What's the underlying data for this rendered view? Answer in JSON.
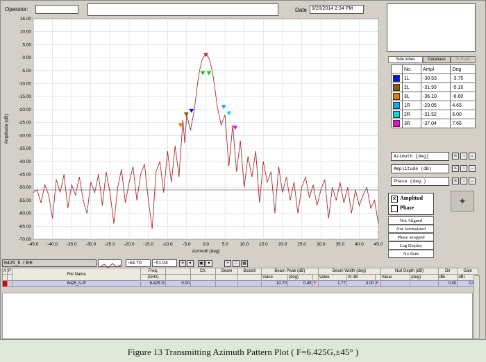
{
  "header": {
    "operator_label": "Operator:",
    "operator_value": "",
    "date_label": "Date",
    "date_value": "9/20/2014 2:34 PM"
  },
  "chart_data": {
    "type": "line",
    "xlabel": "Azimuth [deg]",
    "ylabel": "Amplitude (dB)",
    "xlim": [
      -45,
      45
    ],
    "ylim": [
      -70,
      15
    ],
    "x_ticks": [
      "-45.0",
      "-40.0",
      "-35.0",
      "-30.0",
      "-25.0",
      "-20.0",
      "-15.0",
      "-10.0",
      "-5.0",
      "0.0",
      "5.0",
      "10.0",
      "15.0",
      "20.0",
      "25.0",
      "30.0",
      "35.0",
      "40.0",
      "45.0"
    ],
    "y_ticks": [
      "15.00",
      "10.00",
      "5.00",
      "0.00",
      "-5.00",
      "-10.00",
      "-15.00",
      "-20.00",
      "-25.00",
      "-30.00",
      "-35.00",
      "-40.00",
      "-45.00",
      "-50.00",
      "-55.00",
      "-60.00",
      "-65.00",
      "-70.00"
    ],
    "grid": true,
    "reference_line_y": -51,
    "series": [
      {
        "color": "#a52a2a",
        "x": [
          -45,
          -44,
          -43,
          -42,
          -41,
          -40,
          -39,
          -38,
          -37,
          -36,
          -35,
          -34,
          -33,
          -32,
          -31,
          -30,
          -29,
          -28,
          -27,
          -26,
          -25,
          -24,
          -23,
          -22,
          -21,
          -20,
          -19,
          -18,
          -17,
          -16,
          -15,
          -14,
          -13,
          -12,
          -11,
          -10,
          -9,
          -8,
          -7,
          -6,
          -5.5,
          -5,
          -4,
          -3,
          -2,
          -1.5,
          -1,
          -0.5,
          0,
          0.5,
          1,
          1.5,
          2,
          3,
          4,
          5,
          6,
          7,
          8,
          9,
          10,
          11,
          12,
          13,
          14,
          15,
          16,
          17,
          18,
          19,
          20,
          21,
          22,
          23,
          24,
          25,
          26,
          27,
          28,
          29,
          30,
          31,
          32,
          33,
          34,
          35,
          36,
          37,
          38,
          39,
          40,
          41,
          42,
          43,
          44,
          45
        ],
        "y": [
          -52,
          -51,
          -56,
          -49,
          -53,
          -62,
          -47,
          -52,
          -45,
          -58,
          -49,
          -53,
          -46,
          -55,
          -60,
          -48,
          -52,
          -45,
          -57,
          -44,
          -52,
          -64,
          -50,
          -43,
          -56,
          -48,
          -42,
          -55,
          -45,
          -41,
          -55,
          -66,
          -44,
          -40,
          -52,
          -36,
          -48,
          -34,
          -46,
          -24,
          -33,
          -22,
          -28,
          -20,
          -8,
          -4,
          -1,
          0.5,
          1,
          0.5,
          -1,
          -4,
          -8,
          -19,
          -26,
          -22,
          -42,
          -26,
          -44,
          -32,
          -50,
          -38,
          -46,
          -36,
          -56,
          -40,
          -48,
          -44,
          -60,
          -42,
          -52,
          -46,
          -55,
          -48,
          -60,
          -50,
          -46,
          -54,
          -49,
          -57,
          -51,
          -47,
          -62,
          -50,
          -55,
          -48,
          -56,
          -50,
          -60,
          -51,
          -57,
          -53,
          -50,
          -58,
          -55,
          -64
        ]
      }
    ],
    "markers": [
      {
        "label": "Peak",
        "x": 0.0,
        "y": 1.0,
        "color": "#e02020"
      },
      {
        "label": "1L",
        "x": -3.75,
        "y": -20.53,
        "color": "#0018d8"
      },
      {
        "label": "2L",
        "x": -5.1,
        "y": -21.93,
        "color": "#8b5a00"
      },
      {
        "label": "3L",
        "x": -6.6,
        "y": -26.1,
        "color": "#e08010"
      },
      {
        "label": "1R",
        "x": 4.65,
        "y": -19.05,
        "color": "#10a8e8"
      },
      {
        "label": "2R",
        "x": 6.0,
        "y": -21.52,
        "color": "#10d8d8"
      },
      {
        "label": "3R",
        "x": 7.65,
        "y": -27.04,
        "color": "#e010d8"
      },
      {
        "label": "BW-L",
        "x": -0.8,
        "y": -6.0,
        "color": "#20c020"
      },
      {
        "label": "BW-R",
        "x": 0.8,
        "y": -6.0,
        "color": "#20c020"
      }
    ]
  },
  "side_tabs": [
    "Side lobes",
    "Database",
    "% Ratio"
  ],
  "sidelobes": {
    "headers": [
      "No.",
      "Ampl",
      "Deg"
    ],
    "rows": [
      {
        "no": "1L",
        "ampl": "-30.53",
        "deg": "-3.75",
        "color": "#0018d8"
      },
      {
        "no": "2L",
        "ampl": "-31.93",
        "deg": "-5.10",
        "color": "#8b5a00"
      },
      {
        "no": "3L",
        "ampl": "-36.10",
        "deg": "-6.60",
        "color": "#e08010"
      },
      {
        "no": "1R",
        "ampl": "-29.05",
        "deg": "4.65",
        "color": "#10a8e8"
      },
      {
        "no": "2R",
        "ampl": "-31.52",
        "deg": "6.00",
        "color": "#10d8d8"
      },
      {
        "no": "3R",
        "ampl": "-37.04",
        "deg": "7.65",
        "color": "#e010d8"
      }
    ]
  },
  "axis_controls": [
    {
      "label": "Azimuth  [deg]"
    },
    {
      "label": "Amplitude (dB)"
    },
    {
      "label": "Phase  (deg.)"
    }
  ],
  "legend": {
    "amplitude": "Amplitud",
    "phase": "Phase"
  },
  "status_buttons": [
    "Not Aligned",
    "Not Normalized",
    "Phase wrapped",
    "Log Display",
    "No Skirt"
  ],
  "toolbar": {
    "file_label": "6425_h. r EE",
    "cursor_x": "-44.70",
    "cursor_y": "-51.04"
  },
  "table": {
    "group_headers": [
      "A",
      "P",
      "File Name",
      "Freq.",
      "Ch.",
      "Beam",
      "Bsatch",
      "Beam Peak (dB)",
      "Beam Width (deg)",
      "Null Depth (dB)",
      "Dir",
      "Gain"
    ],
    "sub_headers": [
      "(GHz)",
      "Value",
      "(deg)",
      "Value",
      "At dB",
      "Value",
      "(deg)",
      "dBi",
      "dBi"
    ],
    "row": {
      "file": "6425_h.rff",
      "freq": "6.425 G",
      "ch": "0.00",
      "peak": "10.70",
      "peak_deg": "0.45",
      "flag1": "F",
      "bw": "1.77",
      "bw_at": "3.00",
      "flag2": "F",
      "dir": "0.00",
      "gain": "0.00"
    }
  },
  "caption": "Figure 13    Transmitting Azimuth Pattern Plot ( F=6.425G,±45° )"
}
